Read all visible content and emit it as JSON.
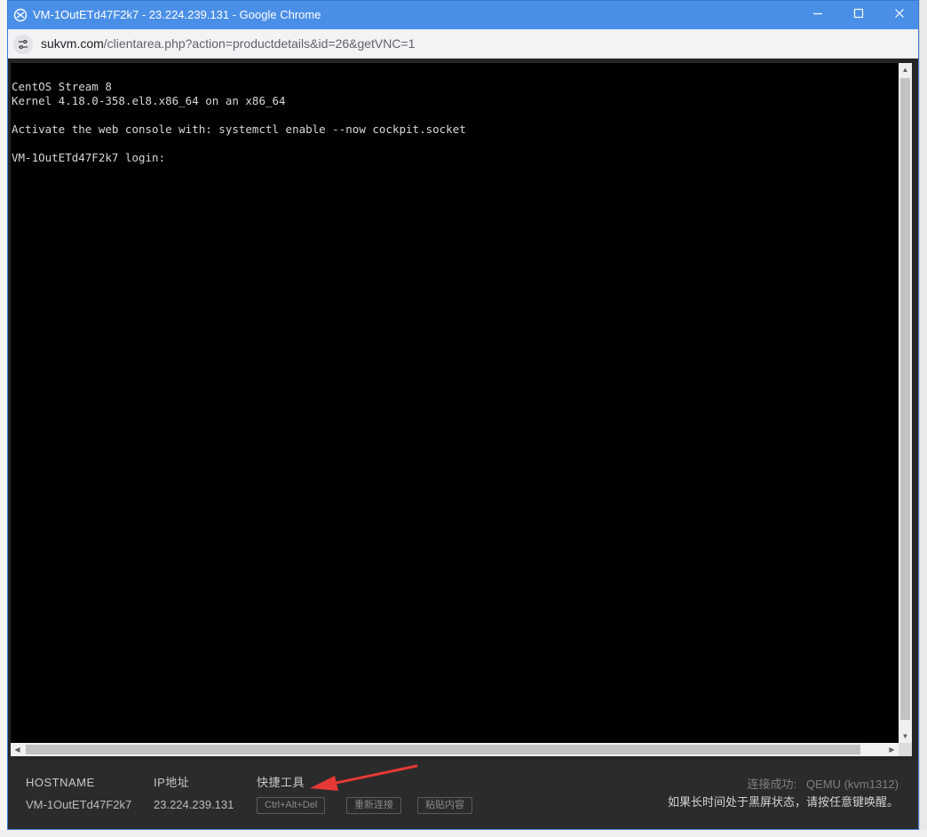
{
  "window": {
    "title": "VM-1OutETd47F2k7 - 23.224.239.131 - Google Chrome"
  },
  "address": {
    "host": "sukvm.com",
    "path": "/clientarea.php?action=productdetails&id=26&getVNC=1"
  },
  "terminal": {
    "lines": [
      "CentOS Stream 8",
      "Kernel 4.18.0-358.el8.x86_64 on an x86_64",
      "",
      "Activate the web console with: systemctl enable --now cockpit.socket",
      "",
      "VM-1OutETd47F2k7 login: "
    ]
  },
  "info": {
    "hostname_label": "HOSTNAME",
    "hostname_value": "VM-1OutETd47F2k7",
    "ip_label": "IP地址",
    "ip_value": "23.224.239.131",
    "tools_label": "快捷工具",
    "tools": [
      "Ctrl+Alt+Del",
      "重新连接",
      "粘贴内容"
    ],
    "status_prefix": "连接成功:",
    "status_value": "QEMU (kvm1312)",
    "hint": "如果长时间处于黑屏状态，请按任意键唤醒。"
  },
  "colors": {
    "titlebar": "#4a8fe7",
    "terminal_bg": "#000000",
    "terminal_fg": "#d8d8d8",
    "infobar_bg": "#2b2b2b",
    "annotation_arrow": "#e53935"
  },
  "icons": {
    "favicon": "app-favicon-icon",
    "site_info": "site-info-icon",
    "minimize": "minimize-icon",
    "maximize": "maximize-icon",
    "close": "close-icon"
  }
}
